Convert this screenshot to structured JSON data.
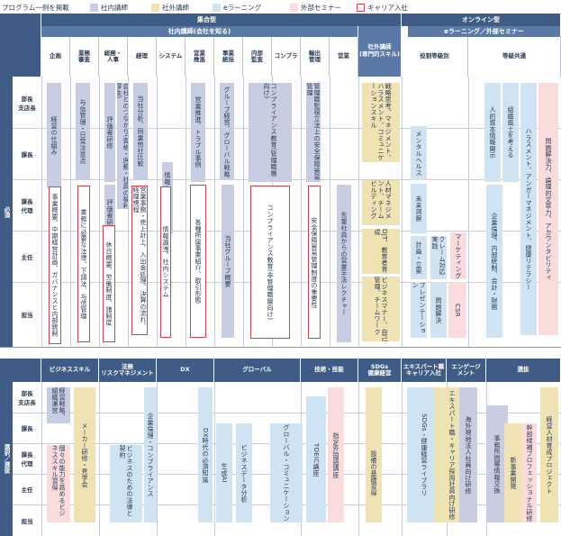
{
  "title": "プログラム一例を掲載",
  "legend": [
    {
      "label": "社内講師",
      "cls": "inhouse"
    },
    {
      "label": "社外講師",
      "cls": "external"
    },
    {
      "label": "eラーニング",
      "cls": "elearn"
    },
    {
      "label": "外部セミナー",
      "cls": "seminar"
    },
    {
      "label": "キャリア入社",
      "cls": "career"
    }
  ],
  "top": {
    "group1": "集合型",
    "group1_sub": "社内講師(会社を知る)",
    "group2": "オンライン型",
    "group2_sub": "eラーニング／外部セミナー",
    "external_col": "社外講師\n(専門的スキル)",
    "columns": [
      "企画",
      "業務\n審査",
      "総務・\n人事",
      "経理",
      "システム",
      "営業\n推進",
      "事業\n統括",
      "内部\n監査",
      "コンプラ",
      "輸出\n管理",
      "営業"
    ],
    "online_cols": [
      "役割等級別",
      "等級共通"
    ],
    "side": "必須",
    "rows": [
      "部長\n支店長",
      "課長",
      "課長\n代理",
      "主任",
      "担当"
    ]
  },
  "bottom": {
    "columns": [
      "ビジネススキル",
      "法務\nリスクマネジメント",
      "DX",
      "グローバル",
      "技術・技能",
      "SDGs\n健康経営",
      "エキスパート職\nキャリア入社",
      "エンゲージ\nメント",
      "選抜"
    ],
    "side": "選択／選抜",
    "rows": [
      "部長\n支店長",
      "課長",
      "課長\n代理",
      "主任",
      "担当"
    ]
  },
  "bars_top": [
    "経営の仕組み",
    "事業概要、中期経営計画、ガバナンスと内部統制",
    "与信管理・日常注意点",
    "業務に必要な法律、下請法、与信管理",
    "評価者研修",
    "評価者研修(実践)",
    "会社とのつながり(資格・庶務・社員の福利厚生)",
    "休日概要、労働制度、諸制度",
    "当社分析、同業他社比較",
    "営業事務・売上計上、入出金処理、決算の流れ、経理規程",
    "情報セキュリティ",
    "情報漏洩、社内システム",
    "営業推進、トラブル事例",
    "各種所属事業紹介、取引形態",
    "グループ経営、グローバル戦略",
    "当社グループ概要",
    "コンプライアンス教育(管理職層向け)",
    "コンプライアンス教育(非管理職層向け)",
    "管理職監視立法上の安全保障貿易管理",
    "安全保障貿易管理制度の重要性",
    "先輩社員からの営業手法レクチャー",
    "戦略思考、マネジメント、ハラスメント、コミュニケーションスキル",
    "人材マネジメント、チームビルディング",
    "OJT、教育者育成",
    "ビジネスマナー、自己管理、チームワーク",
    "メンタルヘルス",
    "未来洞察",
    "計画・立案",
    "クレーム対応実践",
    "マーケティング",
    "問題解決",
    "CSR",
    "プレゼンテーション",
    "人的資本情報開示",
    "組織風土を考える",
    "ハラスメント、アンガーマネジメント、健康リテラシー",
    "企業倫理、内部統制、会計・財務",
    "問題解決力、論理的文章力、アカウンタビリティ"
  ],
  "bars_bottom": [
    "経営戦略、組織運営",
    "個々の能力を高めるビジネススキル習得",
    "メーカー研修・見学会",
    "企業倫理・コンプライアンス",
    "ビジネスのための法律と契約",
    "DX時代の必須知識",
    "生成AI",
    "ビジネスデータ分析",
    "指定外国語講座",
    "TOEIC講座",
    "グローバル・コミュニケーション",
    "各種資格取得補助",
    "設備の基礎習得",
    "SDGs・健康経営ライブラリ",
    "エキスパート職・キャリア採用社員向け研修",
    "海外現地法人社員向け研修",
    "事務所間等情報交換",
    "新事業開発",
    "幹部候補プロフェッショナル研修",
    "経営人材育成プロジェクト"
  ]
}
